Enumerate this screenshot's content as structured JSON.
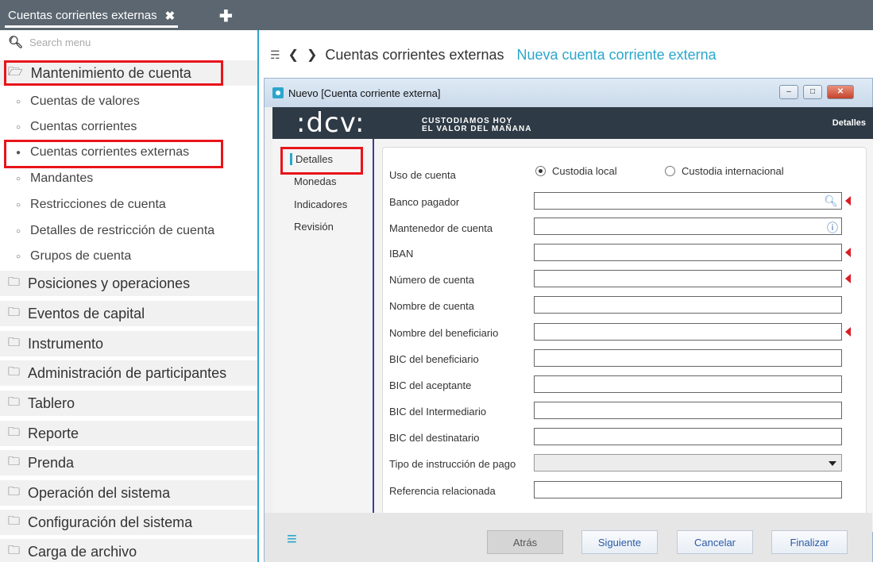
{
  "tabbar": {
    "tab_label": "Cuentas corrientes externas",
    "close_glyph": "✖",
    "add_glyph": "✚"
  },
  "sidebar": {
    "search_placeholder": "Search menu",
    "open_group": "Mantenimiento de cuenta",
    "items": [
      "Cuentas de valores",
      "Cuentas corrientes",
      "Cuentas corrientes externas",
      "Mandantes",
      "Restricciones de cuenta",
      "Detalles de restricción de cuenta",
      "Grupos de cuenta"
    ],
    "groups": [
      "Posiciones y operaciones",
      "Eventos de capital",
      "Instrumento",
      "Administración de participantes",
      "Tablero",
      "Reporte",
      "Prenda",
      "Operación del sistema",
      "Configuración del sistema",
      "Carga de archivo"
    ]
  },
  "breadcrumb": {
    "current": "Cuentas corrientes externas",
    "new": "Nueva cuenta corriente externa"
  },
  "dialog": {
    "title": "Nuevo [Cuenta corriente externa]",
    "banner": {
      "logo": ":dcv:",
      "tagline1": "CUSTODIAMOS HOY",
      "tagline2": "EL VALOR DEL MAÑANA",
      "section": "Detalles"
    },
    "steps": [
      "Detalles",
      "Monedas",
      "Indicadores",
      "Revisión"
    ],
    "form": {
      "uso_label": "Uso de cuenta",
      "radio_local": "Custodia local",
      "radio_intl": "Custodia internacional",
      "selected": "Custodia local",
      "fields": [
        "Banco pagador",
        "Mantenedor de cuenta",
        "IBAN",
        "Número de cuenta",
        "Nombre de cuenta",
        "Nombre del beneficiario",
        "BIC del beneficiario",
        "BIC del aceptante",
        "BIC del Intermediario",
        "BIC del destinatario",
        "Tipo de instrucción de pago",
        "Referencia relacionada"
      ]
    },
    "buttons": {
      "back": "Atrás",
      "next": "Siguiente",
      "cancel": "Cancelar",
      "finish": "Finalizar"
    }
  },
  "colors": {
    "accent": "#2ba6cb",
    "required": "#d91f26",
    "highlight": "#e8141b",
    "topbar": "#5b6670",
    "banner": "#2e3a45"
  }
}
